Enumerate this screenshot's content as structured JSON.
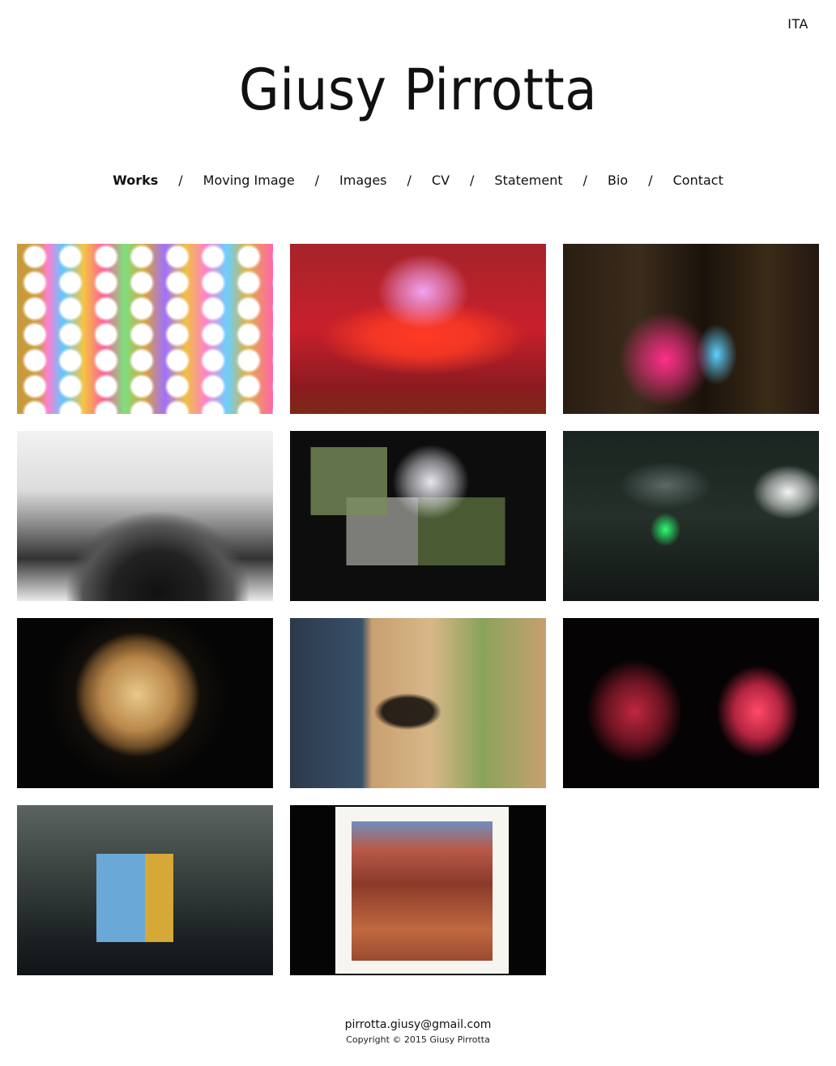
{
  "header": {
    "language_toggle": "ITA",
    "site_title": "Giusy Pirrotta"
  },
  "nav": {
    "items": [
      "Works",
      "Moving Image",
      "Images",
      "CV",
      "Statement",
      "Bio",
      "Contact"
    ],
    "separator": "/",
    "active": "Works"
  },
  "gallery": {
    "thumbnail_count": 11
  },
  "footer": {
    "email": "pirrotta.giusy@gmail.com",
    "copyright": "Copyright © 2015 Giusy Pirrotta"
  }
}
